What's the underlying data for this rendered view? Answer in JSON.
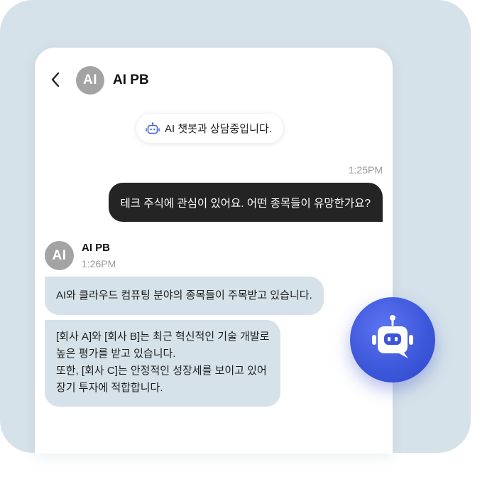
{
  "header": {
    "avatar_initials": "AI",
    "title": "AI PB"
  },
  "status": {
    "text": "AI 챗봇과 상담중입니다.",
    "icon": "robot-icon"
  },
  "messages": [
    {
      "sender": "user",
      "time": "1:25PM",
      "text": "테크 주식에 관심이 있어요. 어떤 종목들이 유망한가요?"
    },
    {
      "sender": "bot",
      "name": "AI PB",
      "avatar_initials": "AI",
      "time": "1:26PM",
      "bubble1": "AI와 클라우드 컴퓨팅 분야의 종목들이 주목받고 있습니다.",
      "bubble2_lines": [
        "[회사 A]와 [회사 B]는 최근 혁신적인 기술 개발로",
        "높은 평가를 받고 있습니다.",
        "또한, [회사 C]는 안정적인 성장세를 보이고 있어",
        "장기 투자에 적합합니다."
      ]
    }
  ],
  "fab": {
    "icon": "chatbot-icon"
  },
  "colors": {
    "backdrop": "#d6e2e9",
    "bot_bubble": "#d6e2e9",
    "user_bubble": "#242424",
    "avatar": "#a3a3a3",
    "accent": "#3c56da",
    "status_icon": "#4a63e0"
  }
}
